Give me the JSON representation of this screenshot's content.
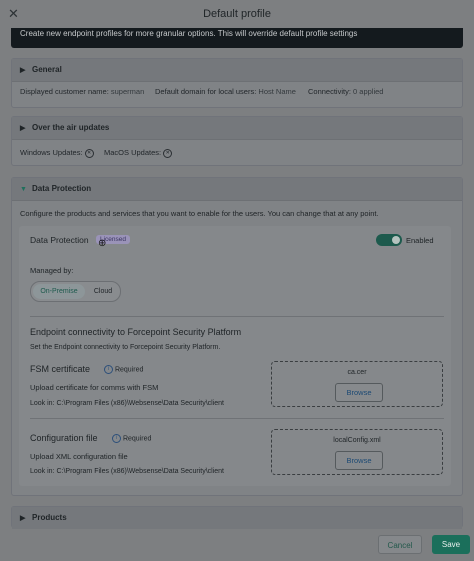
{
  "window": {
    "title": "Default profile",
    "close_icon": "close-icon"
  },
  "banner": "Create new endpoint profiles for more granular options. This will override default profile settings",
  "general": {
    "title": "General",
    "customer_label": "Displayed customer name:",
    "customer_value": "superman",
    "domain_label": "Default domain for local users:",
    "domain_value": "Host Name",
    "connectivity_label": "Connectivity:",
    "connectivity_value": "0 applied"
  },
  "ota": {
    "title": "Over the air updates",
    "windows_label": "Windows Updates:",
    "macos_label": "MacOS Updates:"
  },
  "dp": {
    "title": "Data Protection",
    "description": "Configure the products and services that you want to enable for the users. You can change that at any point.",
    "name": "Data Protection",
    "badge": "Licensed",
    "toggle_label": "Enabled",
    "managed_by": "Managed by:",
    "seg_a": "On-Premise",
    "seg_b": "Cloud",
    "connectivity_title": "Endpoint connectivity to Forcepoint Security Platform",
    "connectivity_desc": "Set the Endpoint connectivity to Forcepoint Security Platform.",
    "fsm_title": "FSM certificate",
    "fsm_required": "Required",
    "fsm_upload": "Upload certificate for comms with FSM",
    "fsm_path": "Look in: C:\\Program Files (x86)\\Websense\\Data Security\\client",
    "fsm_file": "ca.cer",
    "browse": "Browse",
    "cfg_title": "Configuration file",
    "cfg_required": "Required",
    "cfg_upload": "Upload XML configuration file",
    "cfg_path": "Look in: C:\\Program Files (x86)\\Websense\\Data Security\\client",
    "cfg_file": "localConfig.xml"
  },
  "products": {
    "title": "Products"
  },
  "footer": {
    "cancel": "Cancel",
    "save": "Save"
  }
}
